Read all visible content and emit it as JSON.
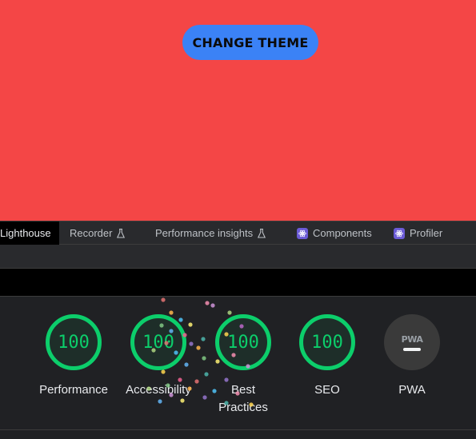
{
  "app": {
    "background": "#f44646",
    "change_theme_label": "CHANGE THEME",
    "button_color": "#3b82f6"
  },
  "devtools": {
    "tabs": [
      {
        "label": "Lighthouse",
        "active": true
      },
      {
        "label": "Recorder",
        "icon": "flask-icon"
      },
      {
        "label": "Performance insights",
        "icon": "flask-icon"
      },
      {
        "label": "Components",
        "icon": "react-icon"
      },
      {
        "label": "Profiler",
        "icon": "react-icon"
      }
    ]
  },
  "report": {
    "scores": [
      {
        "name": "Performance",
        "value": "100"
      },
      {
        "name": "Accessibility",
        "value": "100"
      },
      {
        "name": "Best Practices",
        "value": "100"
      },
      {
        "name": "SEO",
        "value": "100"
      }
    ],
    "pwa": {
      "logo": "PWA",
      "label": "PWA"
    },
    "pass_color": "#0cce6b"
  }
}
